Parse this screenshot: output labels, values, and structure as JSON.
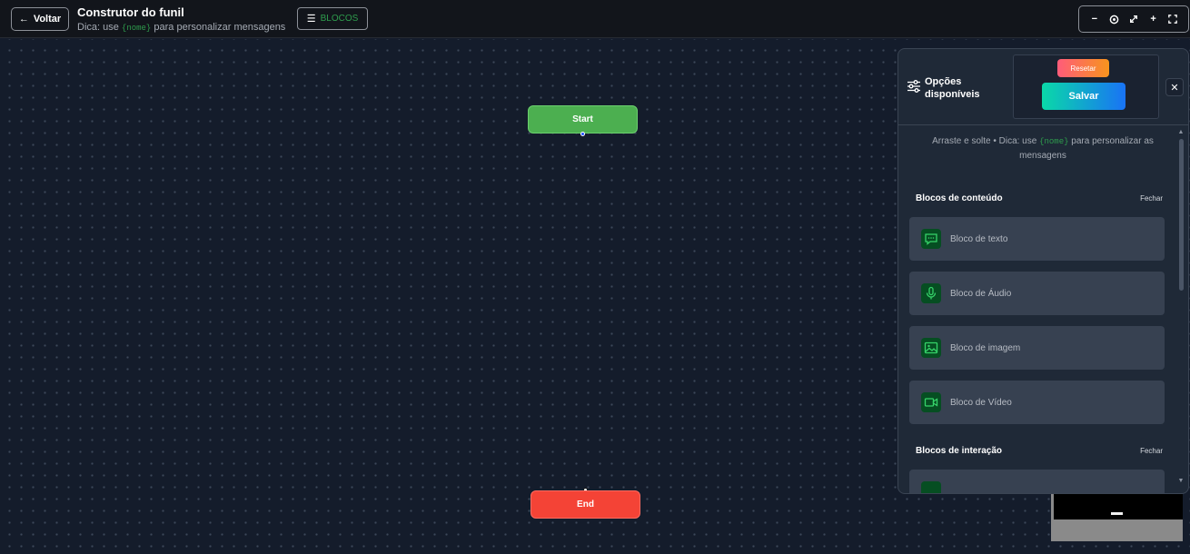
{
  "header": {
    "back_label": "Voltar",
    "title": "Construtor do funil",
    "hint_prefix": "Dica: use",
    "hint_var": "{nome}",
    "hint_suffix": "para personalizar mensagens",
    "blocks_label": "BLOCOS"
  },
  "zoom_controls": {
    "zoom_out": "−",
    "zoom_in": "+"
  },
  "canvas": {
    "start_label": "Start",
    "end_label": "End"
  },
  "panel": {
    "title": "Opções disponíveis",
    "reset_label": "Resetar",
    "save_label": "Salvar",
    "close_label": "✕",
    "hint_prefix": "Arraste e solte • Dica: use",
    "hint_var": "{nome}",
    "hint_suffix": "para personalizar as mensagens",
    "sections": [
      {
        "title": "Blocos de conteúdo",
        "toggle": "Fechar",
        "items": [
          {
            "label": "Bloco de texto",
            "icon": "chat-icon"
          },
          {
            "label": "Bloco de Áudio",
            "icon": "microphone-icon"
          },
          {
            "label": "Bloco de imagem",
            "icon": "image-icon"
          },
          {
            "label": "Bloco de Vídeo",
            "icon": "video-icon"
          }
        ]
      },
      {
        "title": "Blocos de interação",
        "toggle": "Fechar"
      }
    ]
  },
  "colors": {
    "start_node": "#4caf50",
    "end_node": "#f44336",
    "accent_green": "#2e9d4d",
    "panel_bg": "#1f2937",
    "card_bg": "#374151"
  }
}
